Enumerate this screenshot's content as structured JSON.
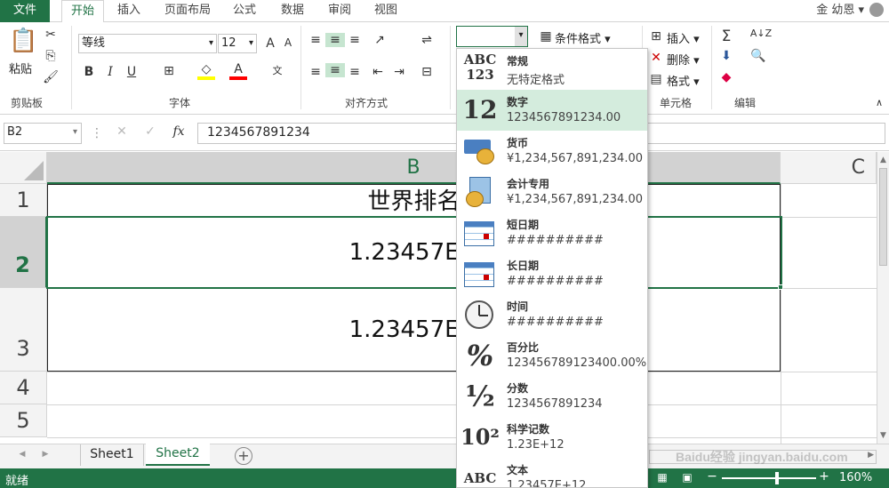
{
  "tabs": {
    "file": "文件",
    "home": "开始",
    "insert": "插入",
    "layout": "页面布局",
    "formulas": "公式",
    "data": "数据",
    "review": "审阅",
    "view": "视图"
  },
  "user": "金 幼恩",
  "ribbon": {
    "clipboard": {
      "paste": "粘贴",
      "label": "剪贴板"
    },
    "font": {
      "name": "等线",
      "size": "12",
      "label": "字体"
    },
    "align": {
      "label": "对齐方式"
    },
    "number": {
      "format_value": ""
    },
    "styles": {
      "conditional": "条件格式"
    },
    "cells": {
      "insert": "插入",
      "delete": "删除",
      "format": "格式",
      "label": "单元格"
    },
    "editing": {
      "label": "编辑"
    }
  },
  "formula": {
    "namebox": "B2",
    "value": "1234567891234",
    "fx": "fx"
  },
  "columns": [
    "B",
    "C"
  ],
  "rows": [
    "1",
    "2",
    "3",
    "4",
    "5"
  ],
  "cells": {
    "b1": "世界排名",
    "b2": "1.23457E+",
    "b3": "1.23457E+"
  },
  "dropdown": [
    {
      "icon": "ABC\n123",
      "name": "常规",
      "example": "无特定格式"
    },
    {
      "icon": "12",
      "name": "数字",
      "example": "1234567891234.00"
    },
    {
      "icon": "",
      "name": "货币",
      "example": "¥1,234,567,891,234.00"
    },
    {
      "icon": "",
      "name": "会计专用",
      "example": " ¥1,234,567,891,234.00"
    },
    {
      "icon": "",
      "name": "短日期",
      "example": "##########"
    },
    {
      "icon": "",
      "name": "长日期",
      "example": "##########"
    },
    {
      "icon": "",
      "name": "时间",
      "example": "##########"
    },
    {
      "icon": "%",
      "name": "百分比",
      "example": "123456789123400.00%"
    },
    {
      "icon": "½",
      "name": "分数",
      "example": "1234567891234"
    },
    {
      "icon": "10²",
      "name": "科学记数",
      "example": "1.23E+12"
    },
    {
      "icon": "ABC",
      "name": "文本",
      "example": "1.23457E+12"
    }
  ],
  "sheets": [
    "Sheet1",
    "Sheet2"
  ],
  "status": {
    "ready": "就绪",
    "zoom": "160%"
  },
  "watermark": "Baidu经验 jingyan.baidu.com"
}
